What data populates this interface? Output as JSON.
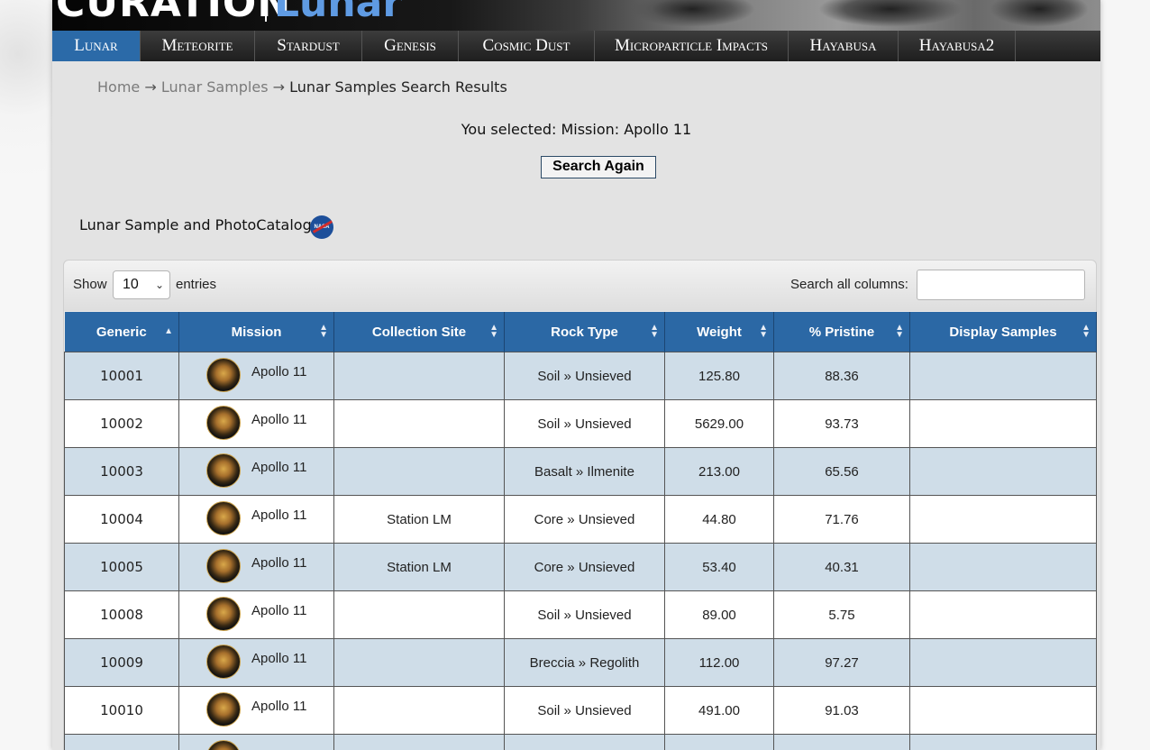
{
  "banner": {
    "logo_main": "CURATION",
    "logo_sub": "Lunar"
  },
  "nav": [
    {
      "label": "Lunar",
      "active": true
    },
    {
      "label": "Meteorite"
    },
    {
      "label": "Stardust"
    },
    {
      "label": "Genesis"
    },
    {
      "label": "Cosmic Dust"
    },
    {
      "label": "Microparticle Impacts"
    },
    {
      "label": "Hayabusa"
    },
    {
      "label": "Hayabusa2"
    }
  ],
  "breadcrumb": {
    "home": "Home",
    "arrow": "→",
    "section": "Lunar Samples",
    "current": "Lunar Samples Search Results"
  },
  "selection_text": "You selected: Mission: Apollo 11",
  "search_again_label": "Search Again",
  "catalog_title": "Lunar Sample and PhotoCatalog",
  "nasa_icon": "NASA",
  "table_controls": {
    "show_label": "Show",
    "show_value": "10",
    "entries_label": "entries",
    "search_label": "Search all columns:",
    "search_value": ""
  },
  "columns": [
    "Generic",
    "Mission",
    "Collection Site",
    "Rock Type",
    "Weight",
    "% Pristine",
    "Display Samples"
  ],
  "rows": [
    {
      "generic": "10001",
      "mission": "Apollo 11",
      "site": "",
      "rock": "Soil » Unsieved",
      "weight": "125.80",
      "pristine": "88.36",
      "display": ""
    },
    {
      "generic": "10002",
      "mission": "Apollo 11",
      "site": "",
      "rock": "Soil » Unsieved",
      "weight": "5629.00",
      "pristine": "93.73",
      "display": ""
    },
    {
      "generic": "10003",
      "mission": "Apollo 11",
      "site": "",
      "rock": "Basalt » Ilmenite",
      "weight": "213.00",
      "pristine": "65.56",
      "display": ""
    },
    {
      "generic": "10004",
      "mission": "Apollo 11",
      "site": "Station LM",
      "rock": "Core » Unsieved",
      "weight": "44.80",
      "pristine": "71.76",
      "display": ""
    },
    {
      "generic": "10005",
      "mission": "Apollo 11",
      "site": "Station LM",
      "rock": "Core » Unsieved",
      "weight": "53.40",
      "pristine": "40.31",
      "display": ""
    },
    {
      "generic": "10008",
      "mission": "Apollo 11",
      "site": "",
      "rock": "Soil » Unsieved",
      "weight": "89.00",
      "pristine": "5.75",
      "display": ""
    },
    {
      "generic": "10009",
      "mission": "Apollo 11",
      "site": "",
      "rock": "Breccia » Regolith",
      "weight": "112.00",
      "pristine": "97.27",
      "display": ""
    },
    {
      "generic": "10010",
      "mission": "Apollo 11",
      "site": "",
      "rock": "Soil » Unsieved",
      "weight": "491.00",
      "pristine": "91.03",
      "display": ""
    }
  ],
  "colors": {
    "nav_active": "#2b6aa8",
    "header_bg": "#2b68a5",
    "row_odd": "#cfdde8",
    "generic_link": "#8b1a1a"
  }
}
